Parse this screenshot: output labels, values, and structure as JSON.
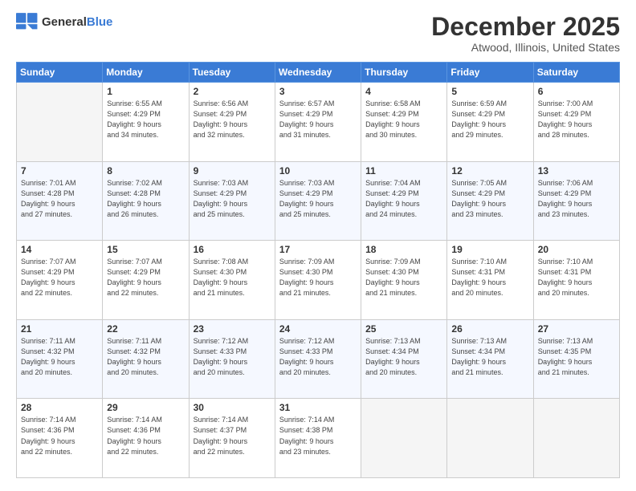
{
  "header": {
    "logo_general": "General",
    "logo_blue": "Blue",
    "title": "December 2025",
    "subtitle": "Atwood, Illinois, United States"
  },
  "days_of_week": [
    "Sunday",
    "Monday",
    "Tuesday",
    "Wednesday",
    "Thursday",
    "Friday",
    "Saturday"
  ],
  "weeks": [
    [
      {
        "day": "",
        "sunrise": "",
        "sunset": "",
        "daylight": "",
        "empty": true
      },
      {
        "day": "1",
        "sunrise": "Sunrise: 6:55 AM",
        "sunset": "Sunset: 4:29 PM",
        "daylight": "Daylight: 9 hours and 34 minutes."
      },
      {
        "day": "2",
        "sunrise": "Sunrise: 6:56 AM",
        "sunset": "Sunset: 4:29 PM",
        "daylight": "Daylight: 9 hours and 32 minutes."
      },
      {
        "day": "3",
        "sunrise": "Sunrise: 6:57 AM",
        "sunset": "Sunset: 4:29 PM",
        "daylight": "Daylight: 9 hours and 31 minutes."
      },
      {
        "day": "4",
        "sunrise": "Sunrise: 6:58 AM",
        "sunset": "Sunset: 4:29 PM",
        "daylight": "Daylight: 9 hours and 30 minutes."
      },
      {
        "day": "5",
        "sunrise": "Sunrise: 6:59 AM",
        "sunset": "Sunset: 4:29 PM",
        "daylight": "Daylight: 9 hours and 29 minutes."
      },
      {
        "day": "6",
        "sunrise": "Sunrise: 7:00 AM",
        "sunset": "Sunset: 4:29 PM",
        "daylight": "Daylight: 9 hours and 28 minutes."
      }
    ],
    [
      {
        "day": "7",
        "sunrise": "Sunrise: 7:01 AM",
        "sunset": "Sunset: 4:28 PM",
        "daylight": "Daylight: 9 hours and 27 minutes."
      },
      {
        "day": "8",
        "sunrise": "Sunrise: 7:02 AM",
        "sunset": "Sunset: 4:28 PM",
        "daylight": "Daylight: 9 hours and 26 minutes."
      },
      {
        "day": "9",
        "sunrise": "Sunrise: 7:03 AM",
        "sunset": "Sunset: 4:29 PM",
        "daylight": "Daylight: 9 hours and 25 minutes."
      },
      {
        "day": "10",
        "sunrise": "Sunrise: 7:03 AM",
        "sunset": "Sunset: 4:29 PM",
        "daylight": "Daylight: 9 hours and 25 minutes."
      },
      {
        "day": "11",
        "sunrise": "Sunrise: 7:04 AM",
        "sunset": "Sunset: 4:29 PM",
        "daylight": "Daylight: 9 hours and 24 minutes."
      },
      {
        "day": "12",
        "sunrise": "Sunrise: 7:05 AM",
        "sunset": "Sunset: 4:29 PM",
        "daylight": "Daylight: 9 hours and 23 minutes."
      },
      {
        "day": "13",
        "sunrise": "Sunrise: 7:06 AM",
        "sunset": "Sunset: 4:29 PM",
        "daylight": "Daylight: 9 hours and 23 minutes."
      }
    ],
    [
      {
        "day": "14",
        "sunrise": "Sunrise: 7:07 AM",
        "sunset": "Sunset: 4:29 PM",
        "daylight": "Daylight: 9 hours and 22 minutes."
      },
      {
        "day": "15",
        "sunrise": "Sunrise: 7:07 AM",
        "sunset": "Sunset: 4:29 PM",
        "daylight": "Daylight: 9 hours and 22 minutes."
      },
      {
        "day": "16",
        "sunrise": "Sunrise: 7:08 AM",
        "sunset": "Sunset: 4:30 PM",
        "daylight": "Daylight: 9 hours and 21 minutes."
      },
      {
        "day": "17",
        "sunrise": "Sunrise: 7:09 AM",
        "sunset": "Sunset: 4:30 PM",
        "daylight": "Daylight: 9 hours and 21 minutes."
      },
      {
        "day": "18",
        "sunrise": "Sunrise: 7:09 AM",
        "sunset": "Sunset: 4:30 PM",
        "daylight": "Daylight: 9 hours and 21 minutes."
      },
      {
        "day": "19",
        "sunrise": "Sunrise: 7:10 AM",
        "sunset": "Sunset: 4:31 PM",
        "daylight": "Daylight: 9 hours and 20 minutes."
      },
      {
        "day": "20",
        "sunrise": "Sunrise: 7:10 AM",
        "sunset": "Sunset: 4:31 PM",
        "daylight": "Daylight: 9 hours and 20 minutes."
      }
    ],
    [
      {
        "day": "21",
        "sunrise": "Sunrise: 7:11 AM",
        "sunset": "Sunset: 4:32 PM",
        "daylight": "Daylight: 9 hours and 20 minutes."
      },
      {
        "day": "22",
        "sunrise": "Sunrise: 7:11 AM",
        "sunset": "Sunset: 4:32 PM",
        "daylight": "Daylight: 9 hours and 20 minutes."
      },
      {
        "day": "23",
        "sunrise": "Sunrise: 7:12 AM",
        "sunset": "Sunset: 4:33 PM",
        "daylight": "Daylight: 9 hours and 20 minutes."
      },
      {
        "day": "24",
        "sunrise": "Sunrise: 7:12 AM",
        "sunset": "Sunset: 4:33 PM",
        "daylight": "Daylight: 9 hours and 20 minutes."
      },
      {
        "day": "25",
        "sunrise": "Sunrise: 7:13 AM",
        "sunset": "Sunset: 4:34 PM",
        "daylight": "Daylight: 9 hours and 20 minutes."
      },
      {
        "day": "26",
        "sunrise": "Sunrise: 7:13 AM",
        "sunset": "Sunset: 4:34 PM",
        "daylight": "Daylight: 9 hours and 21 minutes."
      },
      {
        "day": "27",
        "sunrise": "Sunrise: 7:13 AM",
        "sunset": "Sunset: 4:35 PM",
        "daylight": "Daylight: 9 hours and 21 minutes."
      }
    ],
    [
      {
        "day": "28",
        "sunrise": "Sunrise: 7:14 AM",
        "sunset": "Sunset: 4:36 PM",
        "daylight": "Daylight: 9 hours and 22 minutes."
      },
      {
        "day": "29",
        "sunrise": "Sunrise: 7:14 AM",
        "sunset": "Sunset: 4:36 PM",
        "daylight": "Daylight: 9 hours and 22 minutes."
      },
      {
        "day": "30",
        "sunrise": "Sunrise: 7:14 AM",
        "sunset": "Sunset: 4:37 PM",
        "daylight": "Daylight: 9 hours and 22 minutes."
      },
      {
        "day": "31",
        "sunrise": "Sunrise: 7:14 AM",
        "sunset": "Sunset: 4:38 PM",
        "daylight": "Daylight: 9 hours and 23 minutes."
      },
      {
        "day": "",
        "sunrise": "",
        "sunset": "",
        "daylight": "",
        "empty": true
      },
      {
        "day": "",
        "sunrise": "",
        "sunset": "",
        "daylight": "",
        "empty": true
      },
      {
        "day": "",
        "sunrise": "",
        "sunset": "",
        "daylight": "",
        "empty": true
      }
    ]
  ]
}
